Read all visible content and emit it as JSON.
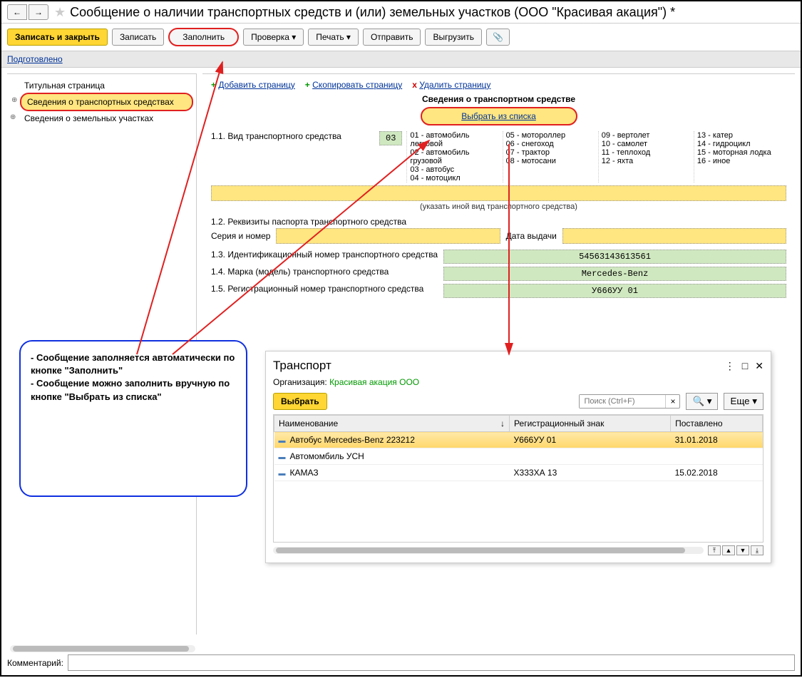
{
  "title": "Сообщение о наличии транспортных средств и (или) земельных участков (ООО \"Красивая акация\") *",
  "toolbar": {
    "write_close": "Записать и закрыть",
    "write": "Записать",
    "fill": "Заполнить",
    "check": "Проверка",
    "print": "Печать",
    "send": "Отправить",
    "export": "Выгрузить"
  },
  "status": "Подготовлено",
  "sidebar": {
    "item0": "Титульная страница",
    "item1": "Сведения о транспортных средствах",
    "item2": "Сведения о земельных участках"
  },
  "page_actions": {
    "add": "Добавить страницу",
    "copy": "Скопировать страницу",
    "del": "Удалить страницу"
  },
  "section": {
    "header": "Сведения о транспортном средстве",
    "select_link": "Выбрать из списка",
    "f11_label": "1.1. Вид транспортного средства",
    "f11_code": "03",
    "types": {
      "c1": [
        "01 - автомобиль легковой",
        "02 - автомобиль грузовой",
        "03 - автобус",
        "04 - мотоцикл"
      ],
      "c2": [
        "05 - мотороллер",
        "06 - снегоход",
        "07 - трактор",
        "08 - мотосани"
      ],
      "c3": [
        "09 - вертолет",
        "10 - самолет",
        "11 - теплоход",
        "12 - яхта"
      ],
      "c4": [
        "13 - катер",
        "14 - гидроцикл",
        "15 - моторная лодка",
        "16 - иное"
      ]
    },
    "other_hint": "(указать иной вид транспортного средства)",
    "f12_label": "1.2. Реквизиты паспорта транспортного средства",
    "serial_label": "Серия и номер",
    "date_label": "Дата выдачи",
    "f13_label": "1.3. Идентификационный номер транспортного средства",
    "f13_val": "54563143613561",
    "f14_label": "1.4. Марка (модель) транспортного средства",
    "f14_val": "Mercedes-Benz",
    "f15_label": "1.5. Регистрационный номер транспортного средства",
    "f15_val": "У666УУ 01"
  },
  "popup": {
    "title": "Транспорт",
    "org_label": "Организация:",
    "org_val": "Красивая акация ООО",
    "select_btn": "Выбрать",
    "search_placeholder": "Поиск (Ctrl+F)",
    "more": "Еще",
    "cols": {
      "name": "Наименование",
      "reg": "Регистрационный знак",
      "date": "Поставлено"
    },
    "rows": [
      {
        "name": "Автобус Mercedes-Benz 223212",
        "reg": "У666УУ 01",
        "date": "31.01.2018"
      },
      {
        "name": "Автомомбиль УСН",
        "reg": "",
        "date": ""
      },
      {
        "name": "КАМАЗ",
        "reg": "Х333ХА 13",
        "date": "15.02.2018"
      }
    ]
  },
  "callout": "- Сообщение заполняется автоматически по кнопке \"Заполнить\"\n- Сообщение можно заполнить вручную по кнопке \"Выбрать из списка\"",
  "comment_label": "Комментарий:"
}
